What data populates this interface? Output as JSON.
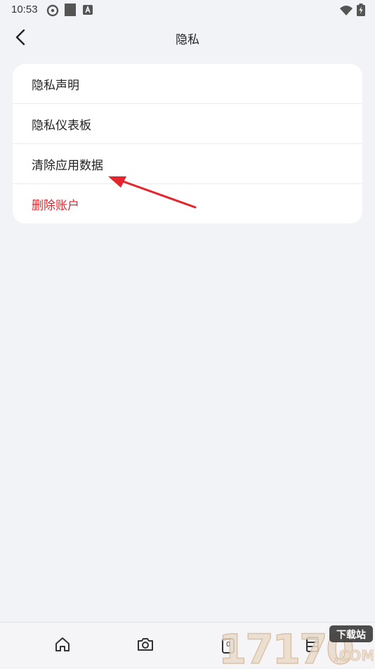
{
  "status_bar": {
    "time": "10:53",
    "icons": [
      "sync-icon",
      "square-icon",
      "a-notification-icon",
      "wifi-icon",
      "battery-icon"
    ]
  },
  "header": {
    "title": "隐私",
    "back_icon": "chevron-left-icon"
  },
  "menu": {
    "items": [
      {
        "label": "隐私声明"
      },
      {
        "label": "隐私仪表板"
      },
      {
        "label": "清除应用数据"
      },
      {
        "label": "删除账户"
      }
    ]
  },
  "annotation": {
    "arrow_color": "#e5242b"
  },
  "bottom_nav": {
    "items": [
      {
        "icon": "home-icon"
      },
      {
        "icon": "camera-icon"
      },
      {
        "icon": "counter-icon",
        "badge": "0"
      },
      {
        "icon": "grid-icon"
      }
    ]
  },
  "watermark": {
    "text": "17170",
    "sub": "下载站",
    "domain": ".COM"
  },
  "colors": {
    "background": "#f2f3f7",
    "card": "#ffffff",
    "danger": "#e5242b"
  }
}
